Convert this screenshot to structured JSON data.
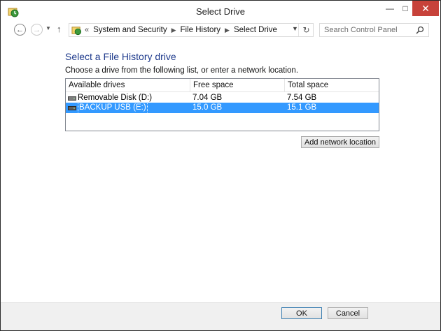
{
  "window": {
    "title": "Select Drive",
    "controls": {
      "minimize": "—",
      "maximize": "□",
      "close": "✕"
    }
  },
  "nav": {
    "back_icon": "back-arrow-icon",
    "forward_icon": "forward-arrow-icon",
    "recent_icon": "chevron-down-icon",
    "up_icon": "up-arrow-icon",
    "overflow": "«",
    "breadcrumbs": [
      "System and Security",
      "File History",
      "Select Drive"
    ],
    "search_placeholder": "Search Control Panel"
  },
  "main": {
    "heading": "Select a File History drive",
    "instructions": "Choose a drive from the following list, or enter a network location.",
    "columns": [
      "Available drives",
      "Free space",
      "Total space"
    ],
    "drives": [
      {
        "name": "Removable Disk (D:)",
        "free": "7.04 GB",
        "total": "7.54 GB",
        "selected": false
      },
      {
        "name": "BACKUP USB (E:)",
        "free": "15.0 GB",
        "total": "15.1 GB",
        "selected": true
      }
    ],
    "add_network_label": "Add network location"
  },
  "footer": {
    "ok_label": "OK",
    "cancel_label": "Cancel"
  },
  "colors": {
    "heading": "#1e3a8c",
    "selection": "#3399ff",
    "close_button": "#c7423a"
  }
}
